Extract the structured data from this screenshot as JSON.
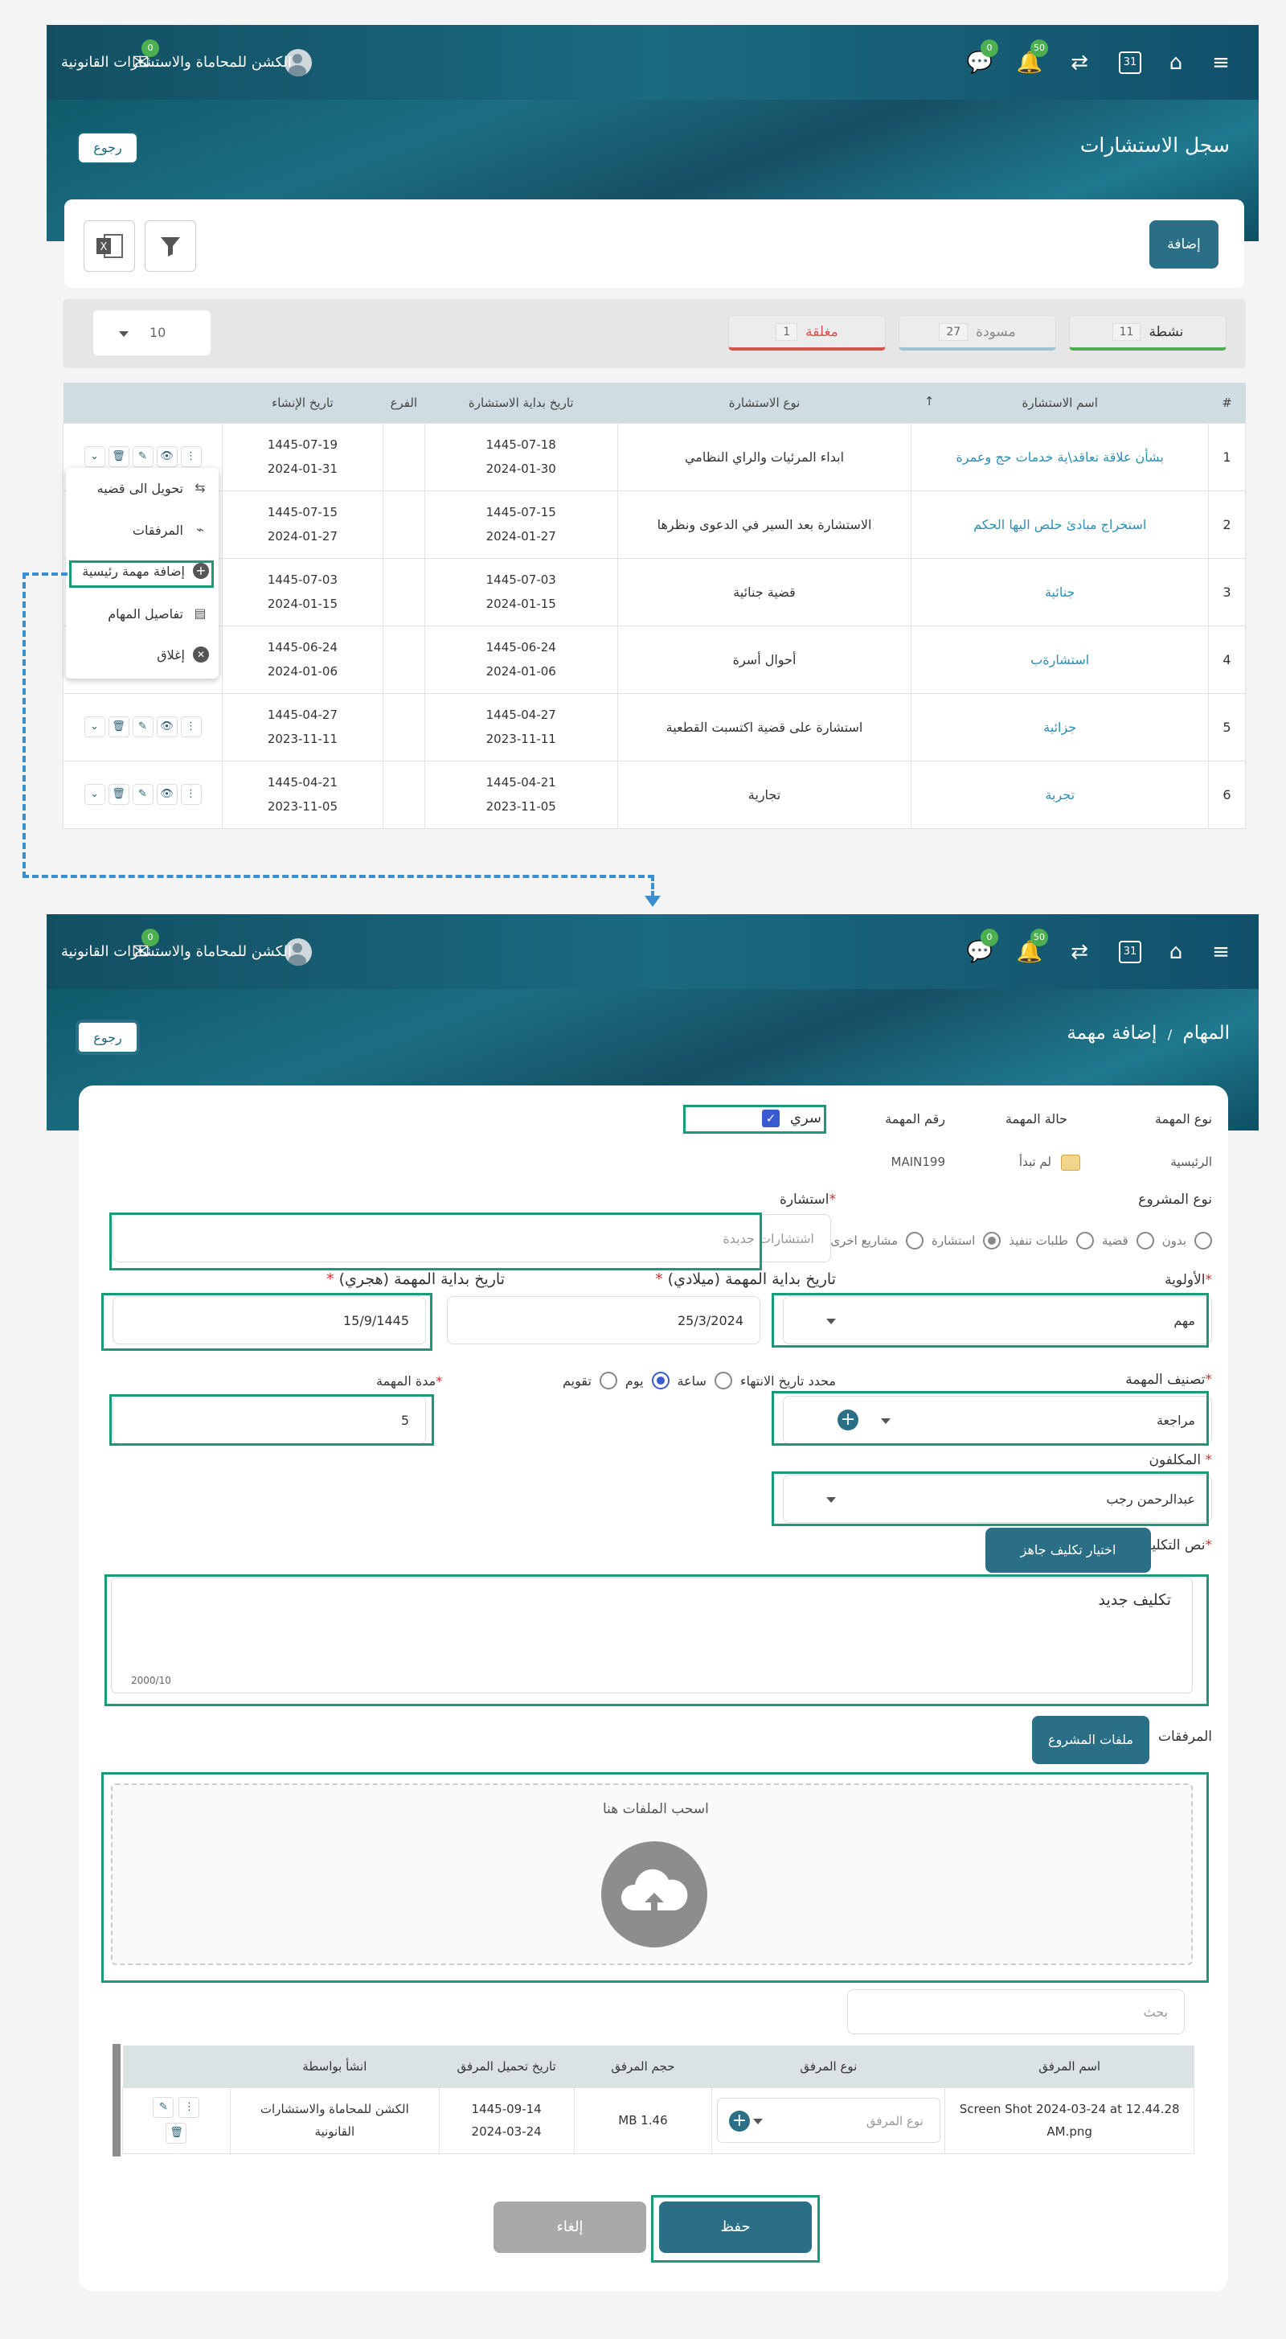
{
  "firm_name": "الكشن للمحاماة والاستشارات القانونية",
  "badges": {
    "chat": "0",
    "messages": "0",
    "bell": "50"
  },
  "calendar_day": "31",
  "list_page": {
    "title": "سجل الاستشارات",
    "back_label": "رجوع",
    "add_label": "إضافة",
    "tabs": [
      {
        "label": "نشطة",
        "count": "11",
        "color": "#4caf50"
      },
      {
        "label": "مسودة",
        "count": "27",
        "color": "#9dc3d1"
      },
      {
        "label": "مغلقة",
        "count": "1",
        "color": "#d9534f"
      }
    ],
    "page_size": "10",
    "columns": [
      "#",
      "اسم الاستشارة",
      "نوع الاستشارة",
      "تاريخ بداية الاستشارة",
      "الفرع",
      "تاريخ الإنشاء"
    ],
    "rows": [
      {
        "n": "1",
        "name": "بشأن علاقة تعاقد\\ية خدمات حج وعمرة",
        "type": "ابداء المرئيات والراي النظامي",
        "start_h": "1445-07-18",
        "start_g": "2024-01-30",
        "branch": "",
        "created_h": "1445-07-19",
        "created_g": "2024-01-31"
      },
      {
        "n": "2",
        "name": "استخراج مبادئ حلص اليها الحكم",
        "type": "الاستشارة بعد السير في الدعوى ونظرها",
        "start_h": "1445-07-15",
        "start_g": "2024-01-27",
        "branch": "",
        "created_h": "1445-07-15",
        "created_g": "2024-01-27"
      },
      {
        "n": "3",
        "name": "جنائية",
        "type": "قضية جنائية",
        "start_h": "1445-07-03",
        "start_g": "2024-01-15",
        "branch": "",
        "created_h": "1445-07-03",
        "created_g": "2024-01-15"
      },
      {
        "n": "4",
        "name": "استشارةب",
        "type": "أحوال أسرة",
        "start_h": "1445-06-24",
        "start_g": "2024-01-06",
        "branch": "",
        "created_h": "1445-06-24",
        "created_g": "2024-01-06"
      },
      {
        "n": "5",
        "name": "جزائية",
        "type": "استشارة على قضية اكتسبت القطعية",
        "start_h": "1445-04-27",
        "start_g": "2023-11-11",
        "branch": "",
        "created_h": "1445-04-27",
        "created_g": "2023-11-11"
      },
      {
        "n": "6",
        "name": "تجربة",
        "type": "تجارية",
        "start_h": "1445-04-21",
        "start_g": "2023-11-05",
        "branch": "",
        "created_h": "1445-04-21",
        "created_g": "2023-11-05"
      }
    ],
    "menu": [
      "تحويل الى قضيه",
      "المرفقات",
      "إضافة مهمة رئيسية",
      "تفاصيل المهام",
      "إغلاق"
    ]
  },
  "form_page": {
    "breadcrumb_root": "المهام",
    "breadcrumb_sep": "/",
    "breadcrumb_current": "إضافة مهمة",
    "back_label": "رجوع",
    "task_type_label": "نوع المهمة",
    "task_status_label": "حالة المهمة",
    "task_number_label": "رقم المهمة",
    "secret_label": "سري",
    "task_type_value": "الرئيسية",
    "task_status_value": "لم تبدأ",
    "task_number_value": "MAIN199",
    "project_type_label": "نوع المشروع",
    "project_types": [
      "بدون",
      "قضية",
      "طلبات تنفيذ",
      "استشارة",
      "مشاريع اخرى"
    ],
    "consultation_label": "استشارة",
    "consultation_placeholder": "اشتشارات جديدة",
    "priority_label": "الأولوية",
    "priority_value": "مهم",
    "start_g_label": "تاريخ بداية المهمة (ميلادي)",
    "start_g_value": "25/3/2024",
    "start_h_label": "تاريخ بداية المهمة (هجري)",
    "start_h_value": "15/9/1445",
    "classification_label": "تصنيف المهمة",
    "classification_value": "مراجعة",
    "duration_options": [
      "محدد تاريخ الانتهاء",
      "ساعة",
      "يوم",
      "تقويم"
    ],
    "duration_label": "مدة المهمة",
    "duration_value": "5",
    "assignees_label": "المكلفون",
    "assignees_value": "عبدالرحمن رجب",
    "assignment_text_label": "نص التكليف",
    "ready_assignment_btn": "اختيار تكليف جاهز",
    "assignment_text": "تكليف جديد",
    "char_counter": "2000/10",
    "attachments_label": "المرفقات",
    "project_files_btn": "ملفات المشروع",
    "drop_text": "اسحب الملفات هنا",
    "search_placeholder": "بحث",
    "file_columns": [
      "اسم المرفق",
      "نوع المرفق",
      "حجم المرفق",
      "تاريخ تحميل المرفق",
      "انشأ بواسطة"
    ],
    "file_row": {
      "name": "Screen Shot 2024-03-24 at 12.44.28 AM.png",
      "type_placeholder": "نوع المرفق",
      "size": "MB 1.46",
      "date_h": "1445-09-14",
      "date_g": "2024-03-24",
      "by": "الكشن للمحاماة والاستشارات القانونية"
    },
    "save_label": "حفظ",
    "cancel_label": "إلغاء"
  }
}
